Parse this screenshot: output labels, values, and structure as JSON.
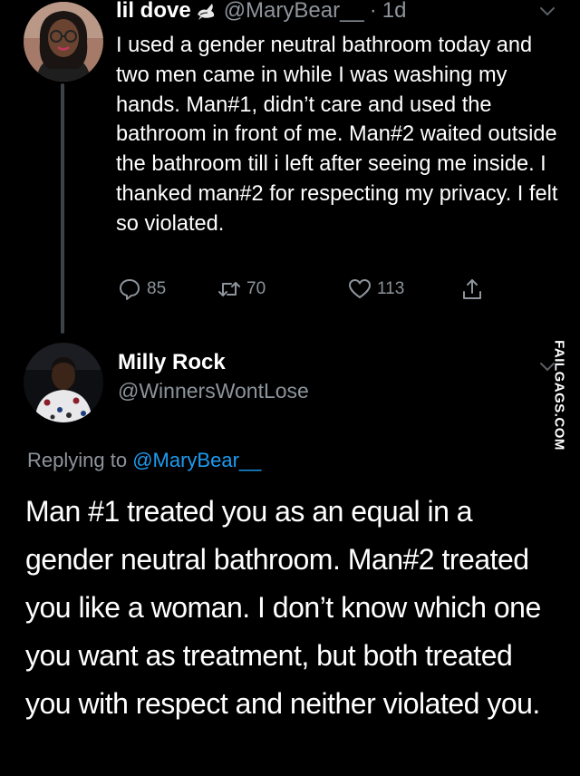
{
  "tweet": {
    "display_name": "lil dove",
    "handle": "@MaryBear__",
    "separator": "·",
    "time": "1d",
    "text": "I used a gender neutral bathroom today and two men came in while I was washing my hands. Man#1, didn’t care and used the bathroom in front of me. Man#2 waited outside the bathroom till i left after seeing me inside. I thanked man#2 for respecting my privacy. I felt so violated.",
    "replies": "85",
    "retweets": "70",
    "likes": "113",
    "icons": [
      "dove-icon",
      "chevron-down-icon",
      "reply-icon",
      "retweet-icon",
      "heart-icon",
      "share-icon"
    ]
  },
  "reply": {
    "display_name": "Milly Rock",
    "handle": "@WinnersWontLose",
    "replying_prefix": "Replying to",
    "replying_to": "@MaryBear__",
    "text": "Man #1 treated you as an equal in a gender neutral bathroom. Man#2 treated you like a woman. I don’t know which one you want as treatment, but both treated you with respect and neither violated you."
  },
  "watermark": "FAILGAGS.COM",
  "colors": {
    "background": "#000000",
    "text": "#ffffff",
    "secondary": "#8d949b",
    "link": "#1d9bf0",
    "thread_line": "#3d4247"
  }
}
